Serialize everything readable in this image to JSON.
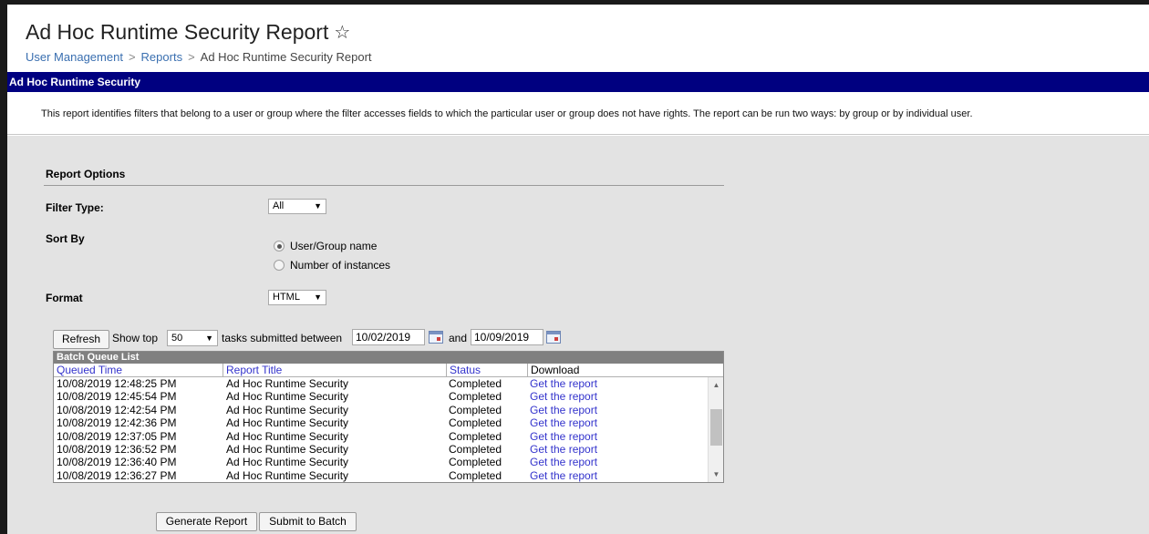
{
  "header": {
    "title": "Ad Hoc Runtime Security Report",
    "favorite_icon": "star-outline-icon",
    "breadcrumb": [
      "User Management",
      "Reports",
      "Ad Hoc Runtime Security Report"
    ],
    "breadcrumb_separator": ">"
  },
  "banner": {
    "title": "Ad Hoc Runtime Security"
  },
  "description": "This report identifies filters that belong to a user or group where the filter accesses fields to which the particular user or group does not have rights. The report can be run two ways: by group or by individual user.",
  "report_options": {
    "title": "Report Options",
    "filter_type": {
      "label": "Filter Type:",
      "value": "All"
    },
    "sort_by": {
      "label": "Sort By",
      "options": [
        {
          "label": "User/Group name",
          "selected": true
        },
        {
          "label": "Number of instances",
          "selected": false
        }
      ]
    },
    "format": {
      "label": "Format",
      "value": "HTML"
    }
  },
  "batch_controls": {
    "refresh_label": "Refresh",
    "show_top_label": "Show top",
    "show_top_value": "50",
    "submitted_between_label": "tasks submitted between",
    "start_date": "10/02/2019",
    "and_label": "and",
    "end_date": "10/09/2019"
  },
  "batch_queue": {
    "title": "Batch Queue List",
    "columns": [
      "Queued Time",
      "Report Title",
      "Status",
      "Download"
    ],
    "rows": [
      [
        "10/08/2019 12:48:25 PM",
        "Ad Hoc Runtime Security",
        "Completed",
        "Get the report"
      ],
      [
        "10/08/2019 12:45:54 PM",
        "Ad Hoc Runtime Security",
        "Completed",
        "Get the report"
      ],
      [
        "10/08/2019 12:42:54 PM",
        "Ad Hoc Runtime Security",
        "Completed",
        "Get the report"
      ],
      [
        "10/08/2019 12:42:36 PM",
        "Ad Hoc Runtime Security",
        "Completed",
        "Get the report"
      ],
      [
        "10/08/2019 12:37:05 PM",
        "Ad Hoc Runtime Security",
        "Completed",
        "Get the report"
      ],
      [
        "10/08/2019 12:36:52 PM",
        "Ad Hoc Runtime Security",
        "Completed",
        "Get the report"
      ],
      [
        "10/08/2019 12:36:40 PM",
        "Ad Hoc Runtime Security",
        "Completed",
        "Get the report"
      ],
      [
        "10/08/2019 12:36:27 PM",
        "Ad Hoc Runtime Security",
        "Completed",
        "Get the report"
      ]
    ]
  },
  "actions": {
    "generate_label": "Generate Report",
    "submit_label": "Submit to Batch"
  },
  "colors": {
    "banner_bg": "#000080",
    "link": "#3333cc",
    "breadcrumb_link": "#3a6fb0",
    "panel_bg": "#e3e3e3"
  }
}
